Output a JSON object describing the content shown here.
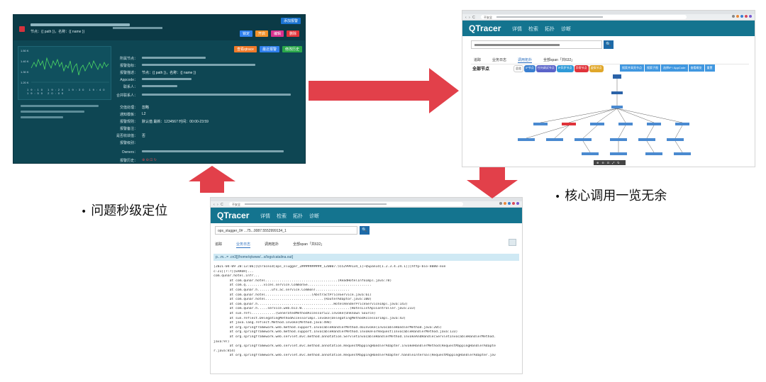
{
  "alert_panel": {
    "add_button": "添加报警",
    "node_line": "节点：{{ path }}，名称：{{ name }}",
    "action_buttons": [
      "锁定",
      "开启",
      "编辑",
      "删除"
    ],
    "sub_actions": [
      "查看qtrace",
      "最近报警",
      "修改历史"
    ],
    "chart_y_labels": [
      "1.50 K",
      "1.40 K",
      "1.30 K",
      "1.20 K"
    ],
    "chart_x_labels": [
      "19:10",
      "19:20",
      "19:30",
      "19:40",
      "19:50",
      "20:00"
    ],
    "fields": {
      "node": "所属节点：",
      "metric": "报警指标：",
      "desc": "报警描述：",
      "desc_value": "节点：{{ path }}，名称：{{ name }}",
      "appcode": "Appcode：",
      "contact": "联系人：",
      "merged": "合并联系人：",
      "handle": "交值处理：",
      "handle_value": "忽略",
      "template": "通知模板：",
      "template_value": "L2",
      "rule": "报警规则：",
      "rule_value": "默认值   最新：1234567   时间：00:00-23:59",
      "remark": "报警备注：",
      "convergence": "是否收敛值：",
      "convergence_value": "否",
      "level": "报警级别：",
      "owners": "Owners：",
      "history": "报警历史："
    }
  },
  "topo_panel": {
    "url_prefix": "不安全",
    "brand": "QTracer",
    "menu": [
      "详情",
      "检索",
      "拓扑",
      "诊断"
    ],
    "search_button": "🔍",
    "subtabs": [
      "追踪",
      "业务日志",
      "调用拓扑",
      "全部span「共632」"
    ],
    "active_subtab": "调用拓扑",
    "all_nodes": "全部节点",
    "pills": [
      {
        "label": "总览",
        "color": "#ffffff",
        "text": "#333333"
      },
      {
        "label": "IP节点",
        "color": "#3a7fd0",
        "text": "#ffffff"
      },
      {
        "label": "任何调试节点",
        "color": "#5a63c9",
        "text": "#ffffff"
      },
      {
        "label": "IP异步节点",
        "color": "#2e9ad8",
        "text": "#ffffff"
      },
      {
        "label": "异常节点",
        "color": "#e0333a",
        "text": "#ffffff"
      },
      {
        "label": "虚拟节点",
        "color": "#e0a72a",
        "text": "#ffffff"
      }
    ],
    "ops": [
      "搜索并高亮节点",
      "搜索子图",
      "选择IP / AppCode",
      "查看概览",
      "重置"
    ],
    "zoom_controls": [
      "⊕",
      "⊖",
      "⊡",
      "⤢",
      "↻"
    ]
  },
  "log_panel": {
    "url_prefix": "不安全",
    "brand": "QTracer",
    "menu": [
      "详情",
      "检索",
      "拓扑",
      "诊断"
    ],
    "search_value": "ops_slugger_0#  ...75...0087.5552999134_1",
    "search_button": "🔍",
    "tabs": [
      "追踪",
      "业务日志",
      "调用拓扑",
      "全部span「共632」"
    ],
    "active_tab": "业务日志",
    "log_path": "p...m...=  .cn3][/home/q/www/...s/logs/catalina.out]",
    "lines": [
      "[2021-04-09 20:13:06][QTraceId[ops_slugger_2##########_120007.5552999134_1]~QSpanId[1.2.3.4.24.1]][http-bio-8080-exe",
      "c-21][?:?][ERROR]...",
      "com.qunar.hotel.infr...",
      "        at com.qunar.hotel....................................(ReadHotelInfoImpl.java:78)",
      "        at com.q.........vices.service.CommonSe................................",
      "        at com.qunar.h.......ufs.ac.service.CommonT.................",
      "        at com.qunar.hotel.......................(AbstractPriceService.java:61)",
      "        at com.qunar.hotel.............................(RouterAdaptor.java:100)",
      "        at com.qunar.h......................................HotelRenderPriceServiceImpl.java:143)",
      "        at com.qunar.h.....service.web.biz.W........................(HotelListApiController.java:233)",
      "        at sun.refl............(GeneratedMethodAccessor522.invoke(Unknown Source)",
      "        at sun.reflect.DelegatingMethodAccessorImpl.invoke(DelegatingMethodAccessorImpl.java:43)",
      "        at java.lang.reflect.Method.invoke(Method.java:498)",
      "        at org.springframework.web.method.support.InvocableHandlerMethod.doInvoke(InvocableHandlerMethod.java:205)",
      "        at org.springframework.web.method.support.InvocableHandlerMethod.invokeForRequest(InvocableHandlerMethod.java:133)",
      "        at org.springframework.web.servlet.mvc.method.annotation.ServletInvocableHandlerMethod.invokeAndHandle(ServletInvocableHandlerMethod.",
      "java:97)",
      "        at org.springframework.web.servlet.mvc.method.annotation.RequestMappingHandlerAdapter.invokeHandlerMethod(RequestMappingHandlerAdapte",
      "r.java:854)",
      "        at org.springframework.web.servlet.mvc.method.annotation.RequestMappingHandlerAdapter.handleInternal(RequestMappingHandlerAdapter.jav"
    ]
  },
  "captions": {
    "left": "问题秒级定位",
    "right": "核心调用一览无余"
  },
  "colors": {
    "arrow": "#e2404a",
    "qtracer_header": "#14748f",
    "alert_bg": "#0e4653"
  }
}
